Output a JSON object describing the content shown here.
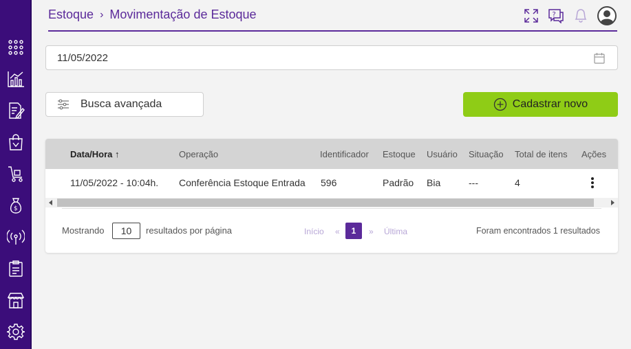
{
  "sidebar": {
    "items": [
      {
        "icon": "apps-grid-icon"
      },
      {
        "icon": "chart-icon"
      },
      {
        "icon": "edit-document-icon"
      },
      {
        "icon": "shopping-bag-icon"
      },
      {
        "icon": "cart-icon"
      },
      {
        "icon": "money-bag-icon"
      },
      {
        "icon": "broadcast-icon"
      },
      {
        "icon": "clipboard-icon"
      },
      {
        "icon": "store-icon"
      },
      {
        "icon": "settings-icon"
      }
    ],
    "background": "#3b0d7a"
  },
  "breadcrumb": {
    "parent": "Estoque",
    "separator": "›",
    "current": "Movimentação de Estoque"
  },
  "header_icons": [
    "fullscreen-icon",
    "help-chat-icon",
    "bell-icon",
    "user-avatar-icon"
  ],
  "filter": {
    "date_value": "11/05/2022",
    "advanced_search_label": "Busca avançada",
    "new_button_label": "Cadastrar novo"
  },
  "table": {
    "columns": [
      "Data/Hora",
      "Operação",
      "Identificador",
      "Estoque",
      "Usuário",
      "Situação",
      "Total de itens",
      "Ações"
    ],
    "sort_indicator": "↑",
    "rows": [
      {
        "datetime": "11/05/2022 - 10:04h.",
        "operation": "Conferência Estoque Entrada",
        "identifier": "596",
        "stock": "Padrão",
        "user": "Bia",
        "status": "---",
        "total_items": "4"
      }
    ]
  },
  "pagination": {
    "showing_label": "Mostrando",
    "per_page_value": "10",
    "per_page_label": "resultados por página",
    "first_label": "Início",
    "prev_label": "«",
    "current_page": "1",
    "next_label": "»",
    "last_label": "Última",
    "results_text": "Foram encontrados 1 resultados"
  },
  "colors": {
    "accent": "#5b2a9a",
    "primary_button": "#8fcc16"
  }
}
